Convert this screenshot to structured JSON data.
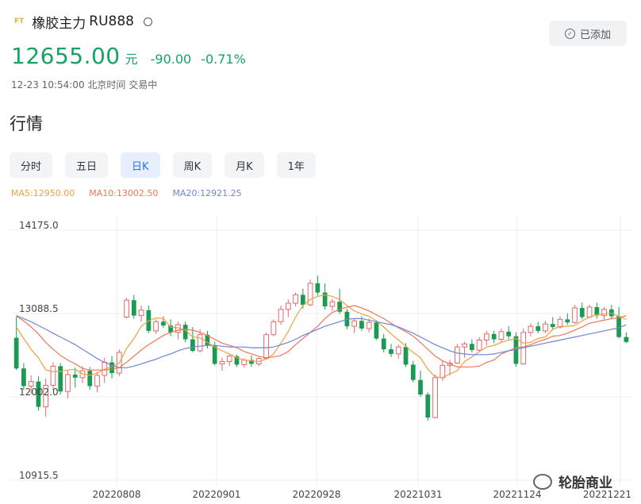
{
  "header": {
    "badge": "FT",
    "name": "橡胶主力",
    "code": "RU888",
    "added_label": "已添加"
  },
  "quote": {
    "price": "12655.00",
    "unit": "元",
    "change": "-90.00",
    "change_pct": "-0.71%",
    "timestamp": "12-23 10:54:00 北京时间 交易中"
  },
  "section_title": "行情",
  "tabs": [
    {
      "label": "分时",
      "active": false
    },
    {
      "label": "五日",
      "active": false
    },
    {
      "label": "日K",
      "active": true
    },
    {
      "label": "周K",
      "active": false
    },
    {
      "label": "月K",
      "active": false
    },
    {
      "label": "1年",
      "active": false
    }
  ],
  "ma": [
    {
      "label": "MA5:12950.00",
      "color": "#f0a040"
    },
    {
      "label": "MA10:13002.50",
      "color": "#ee7755"
    },
    {
      "label": "MA20:12921.25",
      "color": "#6f86d6"
    }
  ],
  "watermark": "轮胎商业",
  "colors": {
    "up": "#e36a6a",
    "down": "#1a9a52",
    "grid": "#eeeeee"
  },
  "chart_data": {
    "type": "candlestick",
    "title": "",
    "y_ticks": [
      "14175.0",
      "13088.5",
      "12002.0",
      "10915.5"
    ],
    "x_ticks": [
      "20220808",
      "20220901",
      "20220928",
      "20221031",
      "20221124",
      "20221221"
    ],
    "ylim": [
      10915.5,
      14175.0
    ],
    "grid": true,
    "candles": [
      [
        12710,
        12980,
        12290,
        12310
      ],
      [
        12310,
        12380,
        12030,
        12080
      ],
      [
        12080,
        12220,
        11980,
        12140
      ],
      [
        12140,
        12210,
        11760,
        11810
      ],
      [
        11810,
        12180,
        11680,
        12090
      ],
      [
        12090,
        12390,
        12030,
        12340
      ],
      [
        12340,
        12380,
        11970,
        12010
      ],
      [
        12010,
        12280,
        11920,
        12230
      ],
      [
        12230,
        12320,
        12060,
        12190
      ],
      [
        12190,
        12340,
        12120,
        12280
      ],
      [
        12280,
        12330,
        12030,
        12080
      ],
      [
        12080,
        12260,
        12000,
        12220
      ],
      [
        12220,
        12450,
        12120,
        12390
      ],
      [
        12390,
        12470,
        12180,
        12250
      ],
      [
        12250,
        12560,
        12210,
        12520
      ],
      [
        12980,
        13230,
        12960,
        13200
      ],
      [
        13200,
        13270,
        12960,
        13000
      ],
      [
        13000,
        13130,
        12920,
        13070
      ],
      [
        13070,
        13130,
        12770,
        12800
      ],
      [
        12800,
        12950,
        12760,
        12920
      ],
      [
        12920,
        12990,
        12840,
        12870
      ],
      [
        12870,
        12950,
        12730,
        12780
      ],
      [
        12780,
        12920,
        12690,
        12880
      ],
      [
        12880,
        12920,
        12650,
        12690
      ],
      [
        12690,
        12850,
        12520,
        12540
      ],
      [
        12540,
        12820,
        12520,
        12750
      ],
      [
        12750,
        12800,
        12570,
        12610
      ],
      [
        12610,
        12660,
        12350,
        12370
      ],
      [
        12370,
        12450,
        12280,
        12400
      ],
      [
        12400,
        12500,
        12340,
        12470
      ],
      [
        12470,
        12490,
        12330,
        12360
      ],
      [
        12360,
        12440,
        12320,
        12420
      ],
      [
        12420,
        12480,
        12330,
        12370
      ],
      [
        12370,
        12460,
        12340,
        12440
      ],
      [
        12440,
        12780,
        12430,
        12750
      ],
      [
        12750,
        12950,
        12730,
        12920
      ],
      [
        12920,
        13130,
        12880,
        13080
      ],
      [
        13080,
        13210,
        12980,
        13160
      ],
      [
        13160,
        13300,
        13120,
        13270
      ],
      [
        13270,
        13350,
        13090,
        13140
      ],
      [
        13140,
        13470,
        13120,
        13420
      ],
      [
        13420,
        13520,
        13260,
        13300
      ],
      [
        13300,
        13420,
        13080,
        13120
      ],
      [
        13120,
        13220,
        13060,
        13180
      ],
      [
        13180,
        13350,
        13020,
        13050
      ],
      [
        13050,
        13090,
        12820,
        12860
      ],
      [
        12860,
        12960,
        12770,
        12930
      ],
      [
        12930,
        12990,
        12800,
        12830
      ],
      [
        12830,
        12960,
        12780,
        12910
      ],
      [
        12910,
        12940,
        12680,
        12700
      ],
      [
        12700,
        12760,
        12520,
        12560
      ],
      [
        12560,
        12630,
        12460,
        12500
      ],
      [
        12500,
        12620,
        12440,
        12590
      ],
      [
        12590,
        12640,
        12330,
        12360
      ],
      [
        12360,
        12410,
        12130,
        12160
      ],
      [
        12160,
        12280,
        11940,
        11970
      ],
      [
        11970,
        12000,
        11630,
        11670
      ],
      [
        11670,
        12230,
        11660,
        12190
      ],
      [
        12190,
        12410,
        12150,
        12350
      ],
      [
        12350,
        12420,
        12220,
        12380
      ],
      [
        12380,
        12630,
        12370,
        12590
      ],
      [
        12590,
        12660,
        12450,
        12630
      ],
      [
        12630,
        12690,
        12520,
        12550
      ],
      [
        12550,
        12720,
        12530,
        12680
      ],
      [
        12680,
        12800,
        12610,
        12760
      ],
      [
        12760,
        12800,
        12640,
        12690
      ],
      [
        12690,
        12830,
        12650,
        12790
      ],
      [
        12790,
        12860,
        12690,
        12730
      ],
      [
        12730,
        12780,
        12330,
        12370
      ],
      [
        12370,
        12830,
        12360,
        12780
      ],
      [
        12780,
        12900,
        12730,
        12860
      ],
      [
        12860,
        12920,
        12770,
        12800
      ],
      [
        12800,
        12930,
        12770,
        12890
      ],
      [
        12890,
        12980,
        12820,
        12850
      ],
      [
        12850,
        12990,
        12830,
        12950
      ],
      [
        12950,
        13030,
        12880,
        12910
      ],
      [
        12910,
        13140,
        12890,
        13100
      ],
      [
        13100,
        13170,
        12950,
        12980
      ],
      [
        12980,
        13140,
        12970,
        13110
      ],
      [
        13110,
        13170,
        12960,
        13000
      ],
      [
        13000,
        13110,
        12950,
        13080
      ],
      [
        13080,
        13140,
        12950,
        12990
      ],
      [
        12990,
        13110,
        12700,
        12720
      ],
      [
        12720,
        12780,
        12640,
        12655
      ]
    ],
    "series": [
      {
        "name": "MA5",
        "values": [
          12850,
          12700,
          12560,
          12450,
          12290,
          12270,
          12270,
          12290,
          12300,
          12240,
          12220,
          12250,
          12300,
          12330,
          12380,
          12570,
          12700,
          12860,
          12930,
          12970,
          12960,
          12850,
          12840,
          12810,
          12720,
          12710,
          12650,
          12590,
          12540,
          12500,
          12450,
          12420,
          12410,
          12400,
          12430,
          12500,
          12640,
          12790,
          12980,
          13130,
          13210,
          13250,
          13270,
          13250,
          13210,
          13130,
          13060,
          13020,
          12990,
          12930,
          12850,
          12760,
          12680,
          12600,
          12520,
          12450,
          12300,
          12200,
          12190,
          12240,
          12280,
          12400,
          12460,
          12530,
          12590,
          12610,
          12650,
          12680,
          12700,
          12640,
          12650,
          12700,
          12720,
          12820,
          12860,
          12860,
          12870,
          12930,
          12980,
          13010,
          13020,
          13030,
          12990,
          12950
        ]
      },
      {
        "name": "MA10",
        "values": [
          12990,
          12930,
          12850,
          12760,
          12650,
          12560,
          12480,
          12420,
          12370,
          12310,
          12290,
          12290,
          12290,
          12300,
          12320,
          12390,
          12470,
          12550,
          12620,
          12680,
          12740,
          12780,
          12810,
          12820,
          12810,
          12780,
          12740,
          12690,
          12640,
          12610,
          12580,
          12530,
          12500,
          12470,
          12450,
          12460,
          12480,
          12530,
          12620,
          12700,
          12780,
          12860,
          12960,
          13040,
          13080,
          13110,
          13130,
          13100,
          13060,
          13010,
          12960,
          12900,
          12840,
          12790,
          12730,
          12650,
          12560,
          12470,
          12410,
          12370,
          12330,
          12330,
          12330,
          12340,
          12390,
          12420,
          12500,
          12540,
          12580,
          12590,
          12620,
          12660,
          12690,
          12730,
          12740,
          12770,
          12810,
          12850,
          12900,
          12920,
          12940,
          12960,
          12970,
          13000
        ]
      },
      {
        "name": "MA20",
        "values": [
          13000,
          12960,
          12920,
          12870,
          12820,
          12770,
          12720,
          12670,
          12620,
          12560,
          12500,
          12440,
          12390,
          12350,
          12320,
          12320,
          12340,
          12370,
          12400,
          12430,
          12470,
          12500,
          12540,
          12570,
          12590,
          12600,
          12610,
          12610,
          12600,
          12590,
          12590,
          12590,
          12580,
          12580,
          12580,
          12590,
          12620,
          12650,
          12690,
          12740,
          12780,
          12820,
          12860,
          12890,
          12920,
          12950,
          12960,
          12960,
          12940,
          12920,
          12900,
          12880,
          12850,
          12810,
          12770,
          12720,
          12670,
          12620,
          12580,
          12540,
          12510,
          12500,
          12490,
          12490,
          12490,
          12500,
          12520,
          12540,
          12560,
          12580,
          12600,
          12620,
          12640,
          12660,
          12680,
          12700,
          12720,
          12740,
          12760,
          12780,
          12800,
          12820,
          12840,
          12880
        ]
      }
    ]
  }
}
